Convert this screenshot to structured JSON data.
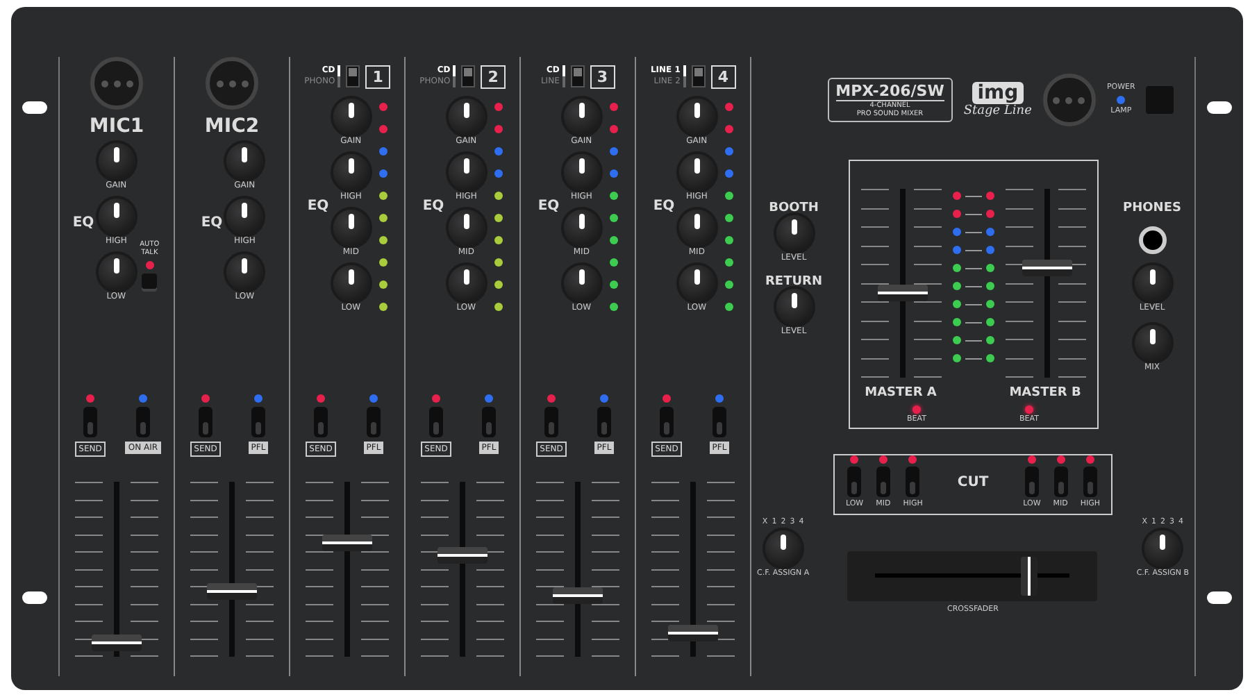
{
  "channels": [
    {
      "kind": "mic",
      "title": "MIC1",
      "eq_label": "EQ",
      "knobs": [
        {
          "label": "GAIN"
        },
        {
          "label": "HIGH"
        },
        {
          "label": "LOW"
        }
      ],
      "auto_talk": {
        "label": "AUTO TALK",
        "on": true,
        "pressed": false
      },
      "buttons": [
        {
          "label": "SEND",
          "kind": "outlined",
          "color": "#e8204c",
          "on": false
        },
        {
          "label": "ON AIR",
          "kind": "filled",
          "color": "#2f6ef0",
          "on": false
        }
      ],
      "fader": {
        "level": 0.04
      }
    },
    {
      "kind": "mic",
      "title": "MIC2",
      "eq_label": "EQ",
      "knobs": [
        {
          "label": "GAIN"
        },
        {
          "label": "HIGH"
        },
        {
          "label": "LOW"
        }
      ],
      "buttons": [
        {
          "label": "SEND",
          "kind": "outlined",
          "color": "#e8204c",
          "on": false
        },
        {
          "label": "PFL",
          "kind": "filled",
          "color": "#2f6ef0",
          "on": false
        }
      ],
      "fader": {
        "level": 0.37
      }
    },
    {
      "kind": "line",
      "number": "1",
      "inputs": [
        {
          "label": "CD",
          "selected": true
        },
        {
          "label": "PHONO",
          "selected": false
        }
      ],
      "eq_label": "EQ",
      "knobs": [
        {
          "label": "GAIN"
        },
        {
          "label": "HIGH"
        },
        {
          "label": "MID"
        },
        {
          "label": "LOW"
        }
      ],
      "meter": [
        {
          "color": "#e8204c"
        },
        {
          "color": "#e8204c"
        },
        {
          "color": "#2f6ef0"
        },
        {
          "color": "#2f6ef0"
        },
        {
          "color": "#a8cc3c"
        },
        {
          "color": "#a8cc3c"
        },
        {
          "color": "#a8cc3c"
        },
        {
          "color": "#a8cc3c"
        },
        {
          "color": "#a8cc3c"
        },
        {
          "color": "#a8cc3c"
        }
      ],
      "buttons": [
        {
          "label": "SEND",
          "kind": "outlined",
          "color": "#e8204c",
          "on": false
        },
        {
          "label": "PFL",
          "kind": "filled",
          "color": "#2f6ef0",
          "on": false
        }
      ],
      "fader": {
        "level": 0.68
      }
    },
    {
      "kind": "line",
      "number": "2",
      "inputs": [
        {
          "label": "CD",
          "selected": true
        },
        {
          "label": "PHONO",
          "selected": false
        }
      ],
      "eq_label": "EQ",
      "knobs": [
        {
          "label": "GAIN"
        },
        {
          "label": "HIGH"
        },
        {
          "label": "MID"
        },
        {
          "label": "LOW"
        }
      ],
      "meter": [
        {
          "color": "#e8204c"
        },
        {
          "color": "#e8204c"
        },
        {
          "color": "#2f6ef0"
        },
        {
          "color": "#2f6ef0"
        },
        {
          "color": "#a8cc3c"
        },
        {
          "color": "#a8cc3c"
        },
        {
          "color": "#a8cc3c"
        },
        {
          "color": "#a8cc3c"
        },
        {
          "color": "#a8cc3c"
        },
        {
          "color": "#a8cc3c"
        }
      ],
      "buttons": [
        {
          "label": "SEND",
          "kind": "outlined",
          "color": "#e8204c",
          "on": false
        },
        {
          "label": "PFL",
          "kind": "filled",
          "color": "#2f6ef0",
          "on": false
        }
      ],
      "fader": {
        "level": 0.6
      }
    },
    {
      "kind": "line",
      "number": "3",
      "inputs": [
        {
          "label": "CD",
          "selected": true
        },
        {
          "label": "LINE",
          "selected": false
        }
      ],
      "eq_label": "EQ",
      "knobs": [
        {
          "label": "GAIN"
        },
        {
          "label": "HIGH"
        },
        {
          "label": "MID"
        },
        {
          "label": "LOW"
        }
      ],
      "meter": [
        {
          "color": "#e8204c"
        },
        {
          "color": "#e8204c"
        },
        {
          "color": "#2f6ef0"
        },
        {
          "color": "#2f6ef0"
        },
        {
          "color": "#3ccc50"
        },
        {
          "color": "#3ccc50"
        },
        {
          "color": "#3ccc50"
        },
        {
          "color": "#3ccc50"
        },
        {
          "color": "#3ccc50"
        },
        {
          "color": "#3ccc50"
        }
      ],
      "buttons": [
        {
          "label": "SEND",
          "kind": "outlined",
          "color": "#e8204c",
          "on": false
        },
        {
          "label": "PFL",
          "kind": "filled",
          "color": "#2f6ef0",
          "on": false
        }
      ],
      "fader": {
        "level": 0.34
      }
    },
    {
      "kind": "line",
      "number": "4",
      "inputs": [
        {
          "label": "LINE 1",
          "selected": true
        },
        {
          "label": "LINE 2",
          "selected": false
        }
      ],
      "eq_label": "EQ",
      "knobs": [
        {
          "label": "GAIN"
        },
        {
          "label": "HIGH"
        },
        {
          "label": "MID"
        },
        {
          "label": "LOW"
        }
      ],
      "meter": [
        {
          "color": "#e8204c"
        },
        {
          "color": "#e8204c"
        },
        {
          "color": "#2f6ef0"
        },
        {
          "color": "#2f6ef0"
        },
        {
          "color": "#3ccc50"
        },
        {
          "color": "#3ccc50"
        },
        {
          "color": "#3ccc50"
        },
        {
          "color": "#3ccc50"
        },
        {
          "color": "#3ccc50"
        },
        {
          "color": "#3ccc50"
        }
      ],
      "buttons": [
        {
          "label": "SEND",
          "kind": "outlined",
          "color": "#e8204c",
          "on": false
        },
        {
          "label": "PFL",
          "kind": "filled",
          "color": "#2f6ef0",
          "on": false
        }
      ],
      "fader": {
        "level": 0.1
      }
    }
  ],
  "brand": {
    "model": "MPX-206/SW",
    "line1": "4-CHANNEL",
    "line2": "PRO SOUND MIXER",
    "logo": "img",
    "sublogo": "Stage Line"
  },
  "power": {
    "power_label": "POWER",
    "on": true,
    "lamp_label": "LAMP"
  },
  "booth": {
    "title": "BOOTH",
    "knob": "LEVEL"
  },
  "return": {
    "title": "RETURN",
    "knob": "LEVEL"
  },
  "master": {
    "faders": [
      {
        "label": "MASTER A",
        "level": 0.45,
        "beat": "BEAT"
      },
      {
        "label": "MASTER B",
        "level": 0.6,
        "beat": "BEAT"
      }
    ],
    "meter": [
      {
        "color": "#e8204c"
      },
      {
        "color": "#e8204c"
      },
      {
        "color": "#2f6ef0"
      },
      {
        "color": "#2f6ef0"
      },
      {
        "color": "#3ccc50"
      },
      {
        "color": "#3ccc50"
      },
      {
        "color": "#3ccc50"
      },
      {
        "color": "#3ccc50"
      },
      {
        "color": "#3ccc50"
      },
      {
        "color": "#3ccc50"
      }
    ]
  },
  "phones": {
    "title": "PHONES",
    "knobs": [
      {
        "label": "LEVEL"
      },
      {
        "label": "MIX"
      }
    ]
  },
  "cut": {
    "title": "CUT",
    "switches": [
      {
        "label": "LOW",
        "on": false
      },
      {
        "label": "MID",
        "on": false
      },
      {
        "label": "HIGH",
        "on": false
      },
      {
        "label": "LOW",
        "on": false
      },
      {
        "label": "MID",
        "on": false
      },
      {
        "label": "HIGH",
        "on": false
      }
    ]
  },
  "cf_assign": [
    {
      "label": "C.F. ASSIGN A",
      "scale": [
        "X",
        "1",
        "2",
        "3",
        "4"
      ]
    },
    {
      "label": "C.F. ASSIGN B",
      "scale": [
        "X",
        "1",
        "2",
        "3",
        "4"
      ]
    }
  ],
  "crossfader": {
    "label": "CROSSFADER",
    "level": 0.82
  }
}
